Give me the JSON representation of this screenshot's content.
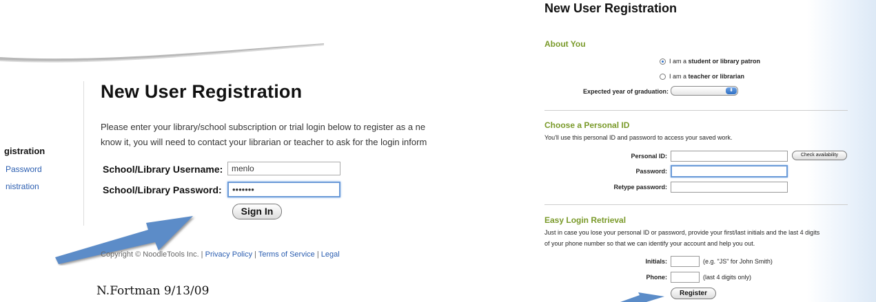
{
  "left": {
    "sidebar": {
      "items": [
        {
          "label": "gistration"
        },
        {
          "label": "Password"
        },
        {
          "label": "nistration"
        }
      ]
    },
    "title": "New User Registration",
    "intro": [
      "Please enter your library/school subscription or trial login below to register as a ne",
      "know it, you will need to contact your librarian or teacher to ask for the login inform"
    ],
    "username_label": "School/Library Username:",
    "username_value": "menlo",
    "password_label": "School/Library Password:",
    "password_value": "•••••••",
    "signin_label": "Sign In",
    "footer": {
      "copyright": "Copyright © NoodleTools Inc. |",
      "privacy": "Privacy Policy",
      "sep1": "|",
      "terms": "Terms of Service",
      "sep2": "|",
      "legal": "Legal"
    },
    "credit": "N.Fortman 9/13/09",
    "colors": {
      "arrow": "#5b8cc8",
      "link": "#2a5db0"
    }
  },
  "right": {
    "title": "New User Registration",
    "about": {
      "heading": "About You",
      "opt_student": {
        "prefix": "I am a ",
        "bold": "student or library patron",
        "selected": true
      },
      "opt_teacher": {
        "prefix": "I am a ",
        "bold": "teacher or librarian",
        "selected": false
      },
      "grad_label": "Expected year of graduation:",
      "grad_value": ""
    },
    "personal": {
      "heading": "Choose a Personal ID",
      "desc": "You'll use this personal ID and password to access your saved work.",
      "id_label": "Personal ID:",
      "check_label": "Check availability",
      "pw_label": "Password:",
      "retype_label": "Retype password:"
    },
    "easy": {
      "heading": "Easy Login Retrieval",
      "desc1": "Just in case you lose your personal ID or password, provide your first/last initials and the last 4 digits",
      "desc2": "of your phone number so that we can identify your account and help you out.",
      "initials_label": "Initials:",
      "initials_hint": "(e.g. \"JS\" for John Smith)",
      "phone_label": "Phone:",
      "phone_hint": "(last 4 digits only)",
      "register_label": "Register"
    },
    "colors": {
      "section_heading": "#7a9a2a"
    }
  }
}
